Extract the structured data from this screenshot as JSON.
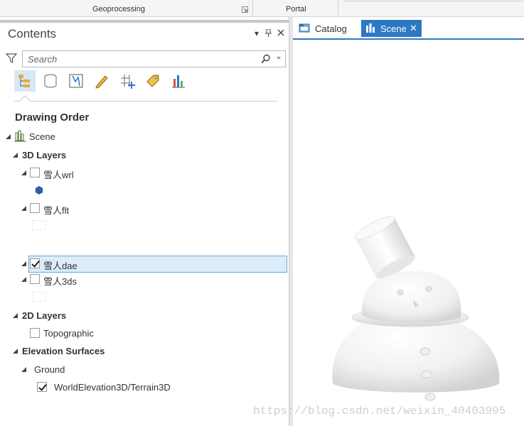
{
  "ribbon": {
    "groups": [
      "Geoprocessing",
      "Portal"
    ]
  },
  "contents": {
    "title": "Contents",
    "search_placeholder": "Search",
    "toolbar_icons": [
      "list-by-drawing-order-icon",
      "list-by-data-source-icon",
      "list-by-selection-icon",
      "list-by-editing-icon",
      "list-by-snapping-icon",
      "list-by-labeling-icon",
      "list-by-charts-icon"
    ],
    "section_title": "Drawing Order",
    "tree": {
      "map_name": "Scene",
      "group_3d": "3D Layers",
      "layers_3d": [
        {
          "name": "雪人wrl",
          "checked": false
        },
        {
          "name": "雪人flt",
          "checked": false
        },
        {
          "name": "雪人dae",
          "checked": true,
          "selected": true
        },
        {
          "name": "雪人3ds",
          "checked": false
        }
      ],
      "group_2d": "2D Layers",
      "layers_2d": [
        {
          "name": "Topographic",
          "checked": false
        }
      ],
      "group_elev": "Elevation Surfaces",
      "ground": "Ground",
      "ground_items": [
        {
          "name": "WorldElevation3D/Terrain3D",
          "checked": true
        }
      ]
    }
  },
  "view": {
    "tabs": [
      {
        "label": "Catalog",
        "active": false
      },
      {
        "label": "Scene",
        "active": true
      }
    ]
  },
  "watermark": "https://blog.csdn.net/weixin_40403995",
  "colors": {
    "accent": "#2b79c2",
    "selection": "#dcecf8",
    "hex_symbol": "#2f5da8"
  }
}
